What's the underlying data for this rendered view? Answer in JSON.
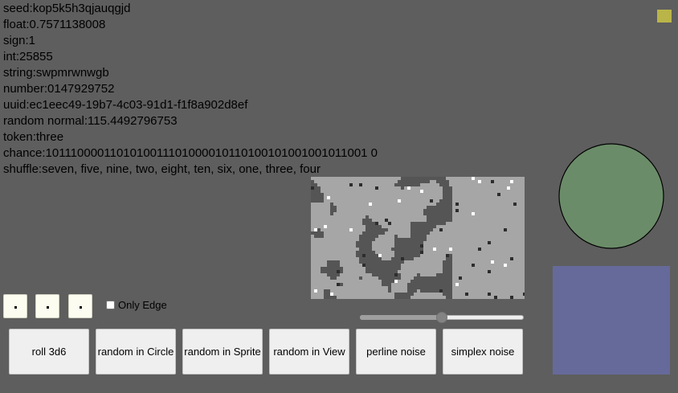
{
  "info": [
    "seed:kop5k5h3qjauqgjd",
    "float:0.7571138008",
    "sign:1",
    "int:25855",
    "string:swpmrwnwgb",
    "number:0147929752",
    "uuid:ec1eec49-19b7-4c03-91d1-f1f8a902d8ef",
    "random normal:115.4492796753",
    "token:three",
    "chance:1011100001101010011101000010110100101001001011001 0",
    "shuffle:seven, five, nine, two, eight, ten, six, one, three, four"
  ],
  "only_edge": {
    "label": "Only Edge",
    "checked": false
  },
  "slider": {
    "value": 0.5
  },
  "buttons": {
    "roll": "roll 3d6",
    "circle": "random in Circle",
    "sprite": "random in Sprite",
    "view": "random in View",
    "perlin": "perline noise",
    "simplex": "simplex noise"
  },
  "colors": {
    "background": "#5e5e5e",
    "corner_square": "#b9b548",
    "circle_fill": "#6b8c69",
    "rect_fill": "#666a9a",
    "noise_light": "#a6a6a6",
    "noise_dark": "#555555",
    "noise_darker": "#2d2d2d",
    "noise_white": "#ffffff"
  }
}
